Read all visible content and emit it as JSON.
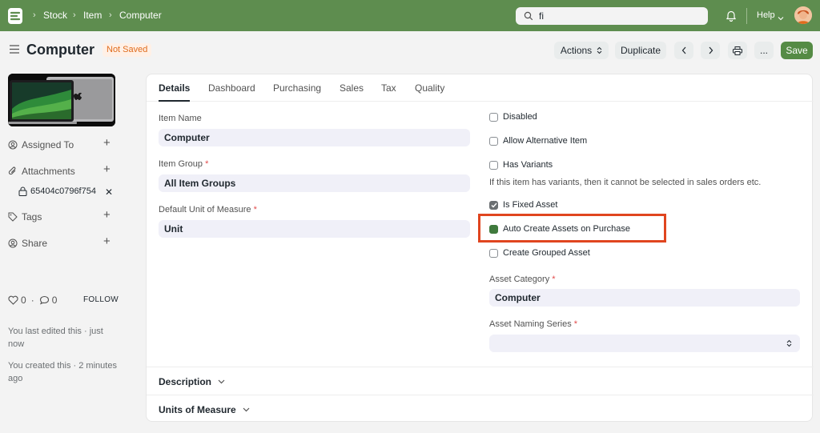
{
  "navbar": {
    "breadcrumbs": [
      "Stock",
      "Item",
      "Computer"
    ],
    "search_value": "fi",
    "help_label": "Help"
  },
  "header": {
    "title": "Computer",
    "status_badge": "Not Saved",
    "actions_label": "Actions",
    "duplicate_label": "Duplicate",
    "more_label": "...",
    "save_label": "Save"
  },
  "sidebar": {
    "assigned_to": "Assigned To",
    "attachments": "Attachments",
    "attachment_file": "65404c0796f754",
    "tags": "Tags",
    "share": "Share",
    "likes": "0",
    "comments": "0",
    "follow_label": "FOLLOW",
    "last_edited": "You last edited this · just now",
    "created": "You created this · 2 minutes ago"
  },
  "tabs": [
    "Details",
    "Dashboard",
    "Purchasing",
    "Sales",
    "Tax",
    "Quality"
  ],
  "form": {
    "item_name_label": "Item Name",
    "item_name_value": "Computer",
    "item_group_label": "Item Group",
    "item_group_value": "All Item Groups",
    "uom_label": "Default Unit of Measure",
    "uom_value": "Unit",
    "required_mark": "*",
    "checkboxes": [
      {
        "label": "Disabled",
        "checked": false
      },
      {
        "label": "Allow Alternative Item",
        "checked": false
      },
      {
        "label": "Has Variants",
        "checked": false
      },
      {
        "label": "Is Fixed Asset",
        "checked": true
      },
      {
        "label": "Auto Create Assets on Purchase",
        "checked": true
      },
      {
        "label": "Create Grouped Asset",
        "checked": false
      }
    ],
    "variants_help": "If this item has variants, then it cannot be selected in sales orders etc.",
    "asset_category_label": "Asset Category",
    "asset_category_value": "Computer",
    "asset_naming_label": "Asset Naming Series",
    "asset_naming_value": ""
  },
  "sections": {
    "description": "Description",
    "units_of_measure": "Units of Measure"
  },
  "colors": {
    "navbar": "#5e8d4f",
    "primary_button": "#558b45",
    "highlight_box": "#e0451f",
    "badge_text": "#e06c1d"
  }
}
